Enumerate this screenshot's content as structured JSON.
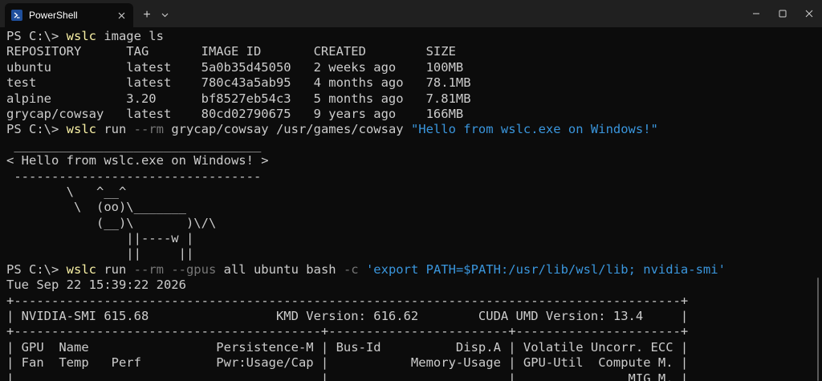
{
  "window": {
    "tab_title": "PowerShell",
    "new_tab_glyph": "+",
    "icons": {
      "tab": "powershell-icon",
      "close_tab": "close-icon",
      "new_tab": "plus-icon",
      "dropdown": "chevron-down-icon",
      "minimize": "minimize-icon",
      "maximize": "maximize-icon",
      "close_window": "close-icon"
    }
  },
  "colors": {
    "background": "#0c0c0c",
    "titlebar": "#202020",
    "text": "#cccccc",
    "command": "#f9f1a5",
    "parameter": "#767676",
    "string": "#3a96dd"
  },
  "terminal": {
    "lines": [
      [
        {
          "t": "PS C:\\> ",
          "c": "plain"
        },
        {
          "t": "wslc",
          "c": "cmd"
        },
        {
          "t": " image ls",
          "c": "plain"
        }
      ],
      [
        {
          "t": "REPOSITORY      TAG       IMAGE ID       CREATED        SIZE",
          "c": "plain"
        }
      ],
      [
        {
          "t": "ubuntu          latest    5a0b35d45050   2 weeks ago    100MB",
          "c": "plain"
        }
      ],
      [
        {
          "t": "test            latest    780c43a5ab95   4 months ago   78.1MB",
          "c": "plain"
        }
      ],
      [
        {
          "t": "alpine          3.20      bf8527eb54c3   5 months ago   7.81MB",
          "c": "plain"
        }
      ],
      [
        {
          "t": "grycap/cowsay   latest    80cd02790675   9 years ago    166MB",
          "c": "plain"
        }
      ],
      [
        {
          "t": "PS C:\\> ",
          "c": "plain"
        },
        {
          "t": "wslc",
          "c": "cmd"
        },
        {
          "t": " run ",
          "c": "plain"
        },
        {
          "t": "--rm",
          "c": "param"
        },
        {
          "t": " grycap/cowsay /usr/games/cowsay ",
          "c": "plain"
        },
        {
          "t": "\"Hello from wslc.exe on Windows!\"",
          "c": "str"
        }
      ],
      [
        {
          "t": " _________________________________",
          "c": "plain"
        }
      ],
      [
        {
          "t": "< Hello from wslc.exe on Windows! >",
          "c": "plain"
        }
      ],
      [
        {
          "t": " ---------------------------------",
          "c": "plain"
        }
      ],
      [
        {
          "t": "        \\   ^__^",
          "c": "plain"
        }
      ],
      [
        {
          "t": "         \\  (oo)\\_______",
          "c": "plain"
        }
      ],
      [
        {
          "t": "            (__)\\       )\\/\\",
          "c": "plain"
        }
      ],
      [
        {
          "t": "                ||----w |",
          "c": "plain"
        }
      ],
      [
        {
          "t": "                ||     ||",
          "c": "plain"
        }
      ],
      [
        {
          "t": "PS C:\\> ",
          "c": "plain"
        },
        {
          "t": "wslc",
          "c": "cmd"
        },
        {
          "t": " run ",
          "c": "plain"
        },
        {
          "t": "--rm --gpus",
          "c": "param"
        },
        {
          "t": " all ubuntu bash ",
          "c": "plain"
        },
        {
          "t": "-c",
          "c": "param"
        },
        {
          "t": " ",
          "c": "plain"
        },
        {
          "t": "'export PATH=$PATH:/usr/lib/wsl/lib; nvidia-smi'",
          "c": "str"
        }
      ],
      [
        {
          "t": "Tue Sep 22 15:39:22 2026",
          "c": "plain"
        }
      ],
      [
        {
          "t": "+-----------------------------------------------------------------------------------------+",
          "c": "plain"
        }
      ],
      [
        {
          "t": "| NVIDIA-SMI 615.68                 KMD Version: 616.62        CUDA UMD Version: 13.4     |",
          "c": "plain"
        }
      ],
      [
        {
          "t": "+-----------------------------------------+------------------------+----------------------+",
          "c": "plain"
        }
      ],
      [
        {
          "t": "| GPU  Name                 Persistence-M | Bus-Id          Disp.A | Volatile Uncorr. ECC |",
          "c": "plain"
        }
      ],
      [
        {
          "t": "| Fan  Temp   Perf          Pwr:Usage/Cap |           Memory-Usage | GPU-Util  Compute M. |",
          "c": "plain"
        }
      ],
      [
        {
          "t": "|                                         |                        |               MIG M. |",
          "c": "plain"
        }
      ]
    ]
  }
}
